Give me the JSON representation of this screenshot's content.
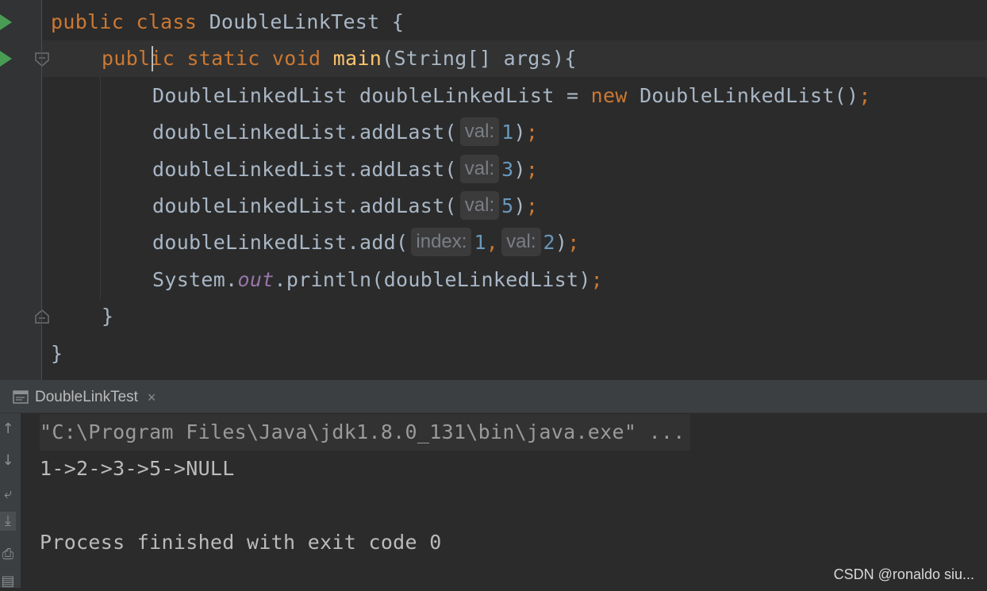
{
  "editor": {
    "lines": [
      {
        "parts": [
          {
            "t": "public class ",
            "c": "kw"
          },
          {
            "t": "DoubleLinkTest {",
            "c": "plain"
          }
        ]
      },
      {
        "parts": [
          {
            "t": "public static void ",
            "c": "kw"
          },
          {
            "t": "main",
            "c": "fn"
          },
          {
            "t": "(String[] args){",
            "c": "plain"
          }
        ]
      },
      {
        "parts": [
          {
            "t": "DoubleLinkedList doubleLinkedList = ",
            "c": "plain"
          },
          {
            "t": "new ",
            "c": "kw"
          },
          {
            "t": "DoubleLinkedList()",
            "c": "plain"
          },
          {
            "t": ";",
            "c": "kw"
          }
        ]
      },
      {
        "parts": [
          {
            "t": "doubleLinkedList.addLast(",
            "c": "plain"
          },
          {
            "t": "val:",
            "c": "hint"
          },
          {
            "t": "1",
            "c": "num"
          },
          {
            "t": ")",
            "c": "plain"
          },
          {
            "t": ";",
            "c": "kw"
          }
        ]
      },
      {
        "parts": [
          {
            "t": "doubleLinkedList.addLast(",
            "c": "plain"
          },
          {
            "t": "val:",
            "c": "hint"
          },
          {
            "t": "3",
            "c": "num"
          },
          {
            "t": ")",
            "c": "plain"
          },
          {
            "t": ";",
            "c": "kw"
          }
        ]
      },
      {
        "parts": [
          {
            "t": "doubleLinkedList.addLast(",
            "c": "plain"
          },
          {
            "t": "val:",
            "c": "hint"
          },
          {
            "t": "5",
            "c": "num"
          },
          {
            "t": ")",
            "c": "plain"
          },
          {
            "t": ";",
            "c": "kw"
          }
        ]
      },
      {
        "parts": [
          {
            "t": "doubleLinkedList.add(",
            "c": "plain"
          },
          {
            "t": "index:",
            "c": "hint"
          },
          {
            "t": "1",
            "c": "num"
          },
          {
            "t": ",",
            "c": "kw"
          },
          {
            "t": "val:",
            "c": "hint"
          },
          {
            "t": "2",
            "c": "num"
          },
          {
            "t": ")",
            "c": "plain"
          },
          {
            "t": ";",
            "c": "kw"
          }
        ]
      },
      {
        "parts": [
          {
            "t": "System.",
            "c": "plain"
          },
          {
            "t": "out",
            "c": "field"
          },
          {
            "t": ".println(doubleLinkedList)",
            "c": "plain"
          },
          {
            "t": ";",
            "c": "kw"
          }
        ]
      },
      {
        "parts": [
          {
            "t": "}",
            "c": "plain"
          }
        ]
      },
      {
        "parts": [
          {
            "t": "}",
            "c": "plain"
          }
        ]
      }
    ]
  },
  "run_panel": {
    "tab_label": "DoubleLinkTest",
    "tab_close": "×",
    "console": {
      "command": "\"C:\\Program Files\\Java\\jdk1.8.0_131\\bin\\java.exe\" ...",
      "output": "1->2->3->5->NULL",
      "exit_message": "Process finished with exit code 0"
    }
  },
  "watermark": "CSDN @ronaldo siu...",
  "colors": {
    "keyword": "#cc7832",
    "method": "#ffc66d",
    "number": "#6897bb",
    "static_field": "#9876aa",
    "plain": "#a9b7c6",
    "run_icon": "#499c54"
  }
}
